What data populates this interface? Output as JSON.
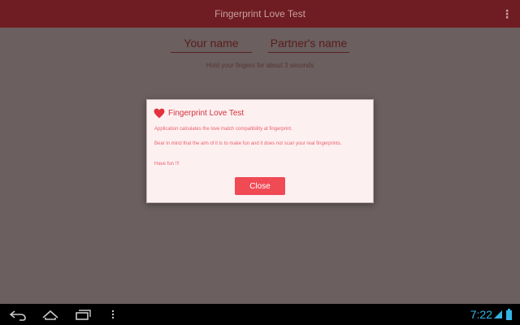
{
  "app": {
    "title": "Fingerprint Love Test"
  },
  "form": {
    "your_name_placeholder": "Your name",
    "partner_name_placeholder": "Partner's name",
    "hint": "Hold your fingers for about 3 seconds"
  },
  "dialog": {
    "title": "Fingerprint Love Test",
    "paragraphs": [
      "Application calculates the love match compatibility at fingerprint.",
      "Bear in mind that the aim of it is to make fun and it does not scan your real fingerprints.",
      "Have fun !!!"
    ],
    "close_label": "Close"
  },
  "status": {
    "time": "7:22"
  },
  "colors": {
    "action_bar": "#6f1c22",
    "background_dim": "#6b5f5f",
    "accent": "#f04a55",
    "dialog_bg": "#fdf0f1",
    "clock": "#33b5e5"
  },
  "icons": {
    "overflow": "overflow-menu-icon",
    "heart": "heart-icon",
    "back": "back-icon",
    "home": "home-icon",
    "recents": "recents-icon",
    "menu": "menu-dots-icon",
    "wifi": "wifi-icon",
    "battery": "battery-icon"
  }
}
